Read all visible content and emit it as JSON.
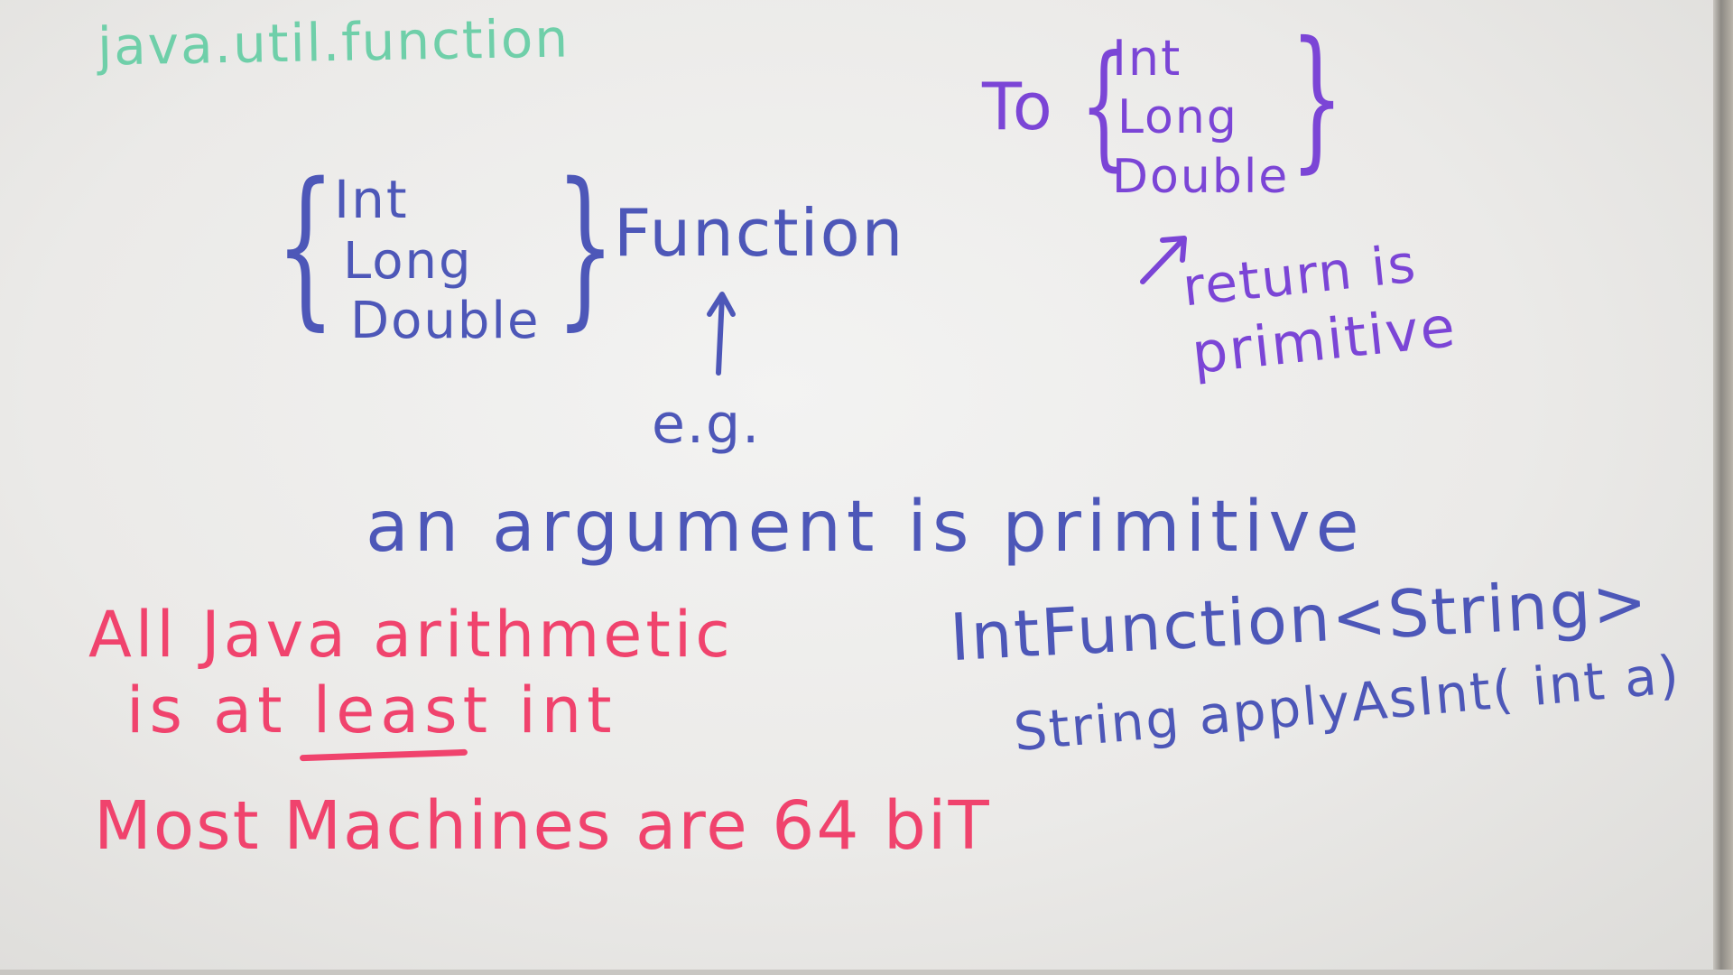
{
  "whiteboard": {
    "package": "java.util.function",
    "prefix_group": {
      "types": [
        "Int",
        "Long",
        "Double"
      ],
      "suffix": "Function"
    },
    "eg_label": "e.g.",
    "argument_note": "an argument is primitive",
    "to_group": {
      "prefix": "To",
      "types": [
        "Int",
        "Long",
        "Double"
      ]
    },
    "return_note": [
      "return is",
      "primitive"
    ],
    "arithmetic_note": [
      "All Java arithmetic",
      "is at least int"
    ],
    "machines_note": "Most Machines are 64 biT",
    "example": {
      "signature": "IntFunction<String>",
      "method": "String applyAsInt( int a)"
    },
    "colors": {
      "green": "#6fcfa9",
      "blue": "#4d57b8",
      "purple": "#7b45d6",
      "red": "#f0436d"
    }
  }
}
